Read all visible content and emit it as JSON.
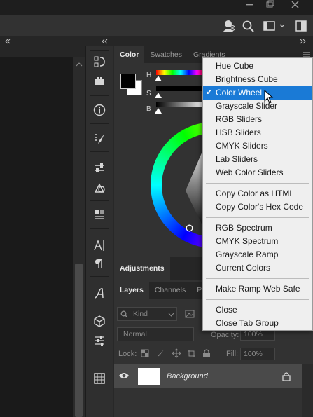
{
  "panel_tabs": [
    "Color",
    "Swatches",
    "Gradients"
  ],
  "color_sliders": [
    "H",
    "S",
    "B"
  ],
  "adjustments_tab": "Adjustments",
  "layers_tabs": [
    "Layers",
    "Channels",
    "Pa"
  ],
  "layers": {
    "kind_label": "Kind",
    "blend_mode": "Normal",
    "opacity_label": "Opacity:",
    "opacity_value": "100%",
    "lock_label": "Lock:",
    "fill_label": "Fill:",
    "fill_value": "100%",
    "layer_name": "Background"
  },
  "menu": {
    "group1": [
      "Hue Cube",
      "Brightness Cube",
      "Color Wheel",
      "Grayscale Slider",
      "RGB Sliders",
      "HSB Sliders",
      "CMYK Sliders",
      "Lab Sliders",
      "Web Color Sliders"
    ],
    "selected": "Color Wheel",
    "group2": [
      "Copy Color as HTML",
      "Copy Color's Hex Code"
    ],
    "group3": [
      "RGB Spectrum",
      "CMYK Spectrum",
      "Grayscale Ramp",
      "Current Colors"
    ],
    "group4": [
      "Make Ramp Web Safe"
    ],
    "group5": [
      "Close",
      "Close Tab Group"
    ]
  },
  "colors": {
    "menu_highlight": "#1a7ad6",
    "panel_bg": "#323232",
    "foreground_swatch": "#000000",
    "background_swatch": "#ffffff"
  }
}
